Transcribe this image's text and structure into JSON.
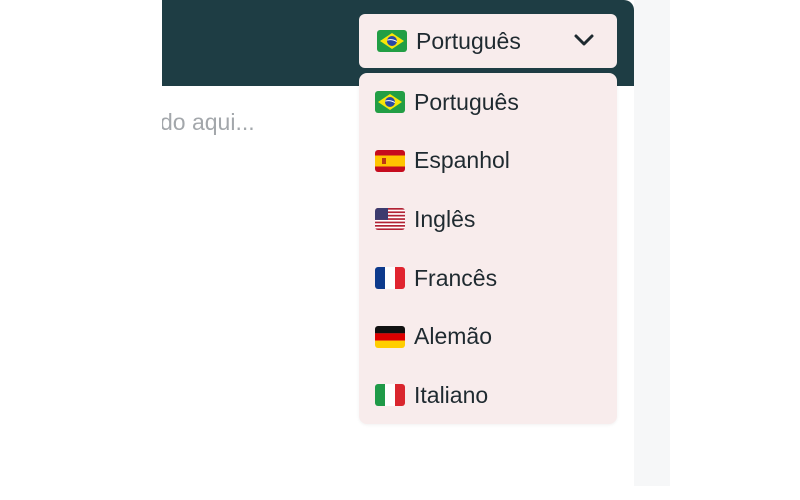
{
  "editor": {
    "placeholder": "do aqui..."
  },
  "language_selector": {
    "selected_label": "Português",
    "selected_flag": "brazil-flag-icon",
    "options": [
      {
        "label": "Português",
        "flag": "brazil-flag-icon"
      },
      {
        "label": "Espanhol",
        "flag": "spain-flag-icon"
      },
      {
        "label": "Inglês",
        "flag": "usa-flag-icon"
      },
      {
        "label": "Francês",
        "flag": "france-flag-icon"
      },
      {
        "label": "Alemão",
        "flag": "germany-flag-icon"
      },
      {
        "label": "Italiano",
        "flag": "italy-flag-icon"
      }
    ]
  },
  "colors": {
    "header": "#1e3d44",
    "dropdown_bg": "#f8ecec",
    "text": "#1f2a30",
    "placeholder": "#a3a7ab"
  }
}
